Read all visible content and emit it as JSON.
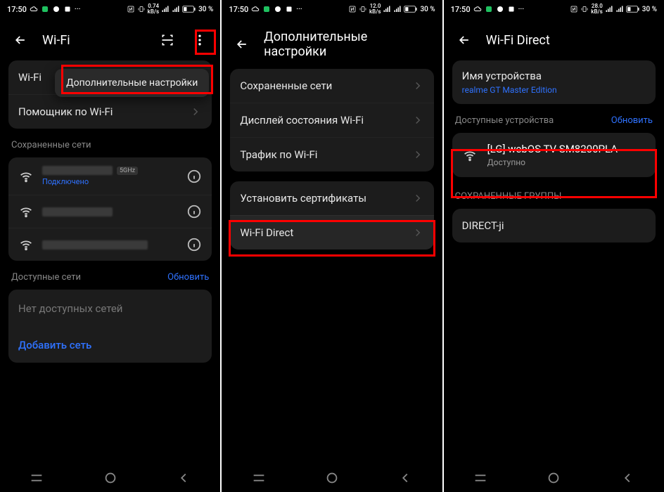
{
  "status_bar": {
    "time": "17:50",
    "net_speed_value": "0.74",
    "net_speed_unit": "kB/s",
    "net_speed_value_2": "12.0",
    "net_speed_value_3": "28.0",
    "battery_percent": "30 %"
  },
  "screen1": {
    "title": "Wi-Fi",
    "dropdown_item": "Дополнительные настройки",
    "row_wifi": "Wi-Fi",
    "row_assistant": "Помощник по Wi-Fi",
    "section_saved": "Сохраненные сети",
    "net1_badge": "5GHz",
    "net1_status": "Подключено",
    "section_available": "Доступные сети",
    "refresh": "Обновить",
    "no_networks": "Нет доступных сетей",
    "add_network": "Добавить сеть"
  },
  "screen2": {
    "title": "Дополнительные настройки",
    "row_saved_nets": "Сохраненные сети",
    "row_display_status": "Дисплей состояния Wi-Fi",
    "row_traffic": "Трафик по Wi-Fi",
    "row_install_certs": "Установить сертификаты",
    "row_wifi_direct": "Wi-Fi Direct"
  },
  "screen3": {
    "title": "Wi-Fi Direct",
    "device_name_label": "Имя устройства",
    "device_name_value": "realme GT Master Edition",
    "section_available": "Доступные устройства",
    "refresh": "Обновить",
    "device_found": "[LG] webOS TV SM8200PLA",
    "device_status": "Доступно",
    "section_saved_groups": "СОХРАНЕННЫЕ ГРУППЫ",
    "group_name": "DIRECT-ji"
  }
}
